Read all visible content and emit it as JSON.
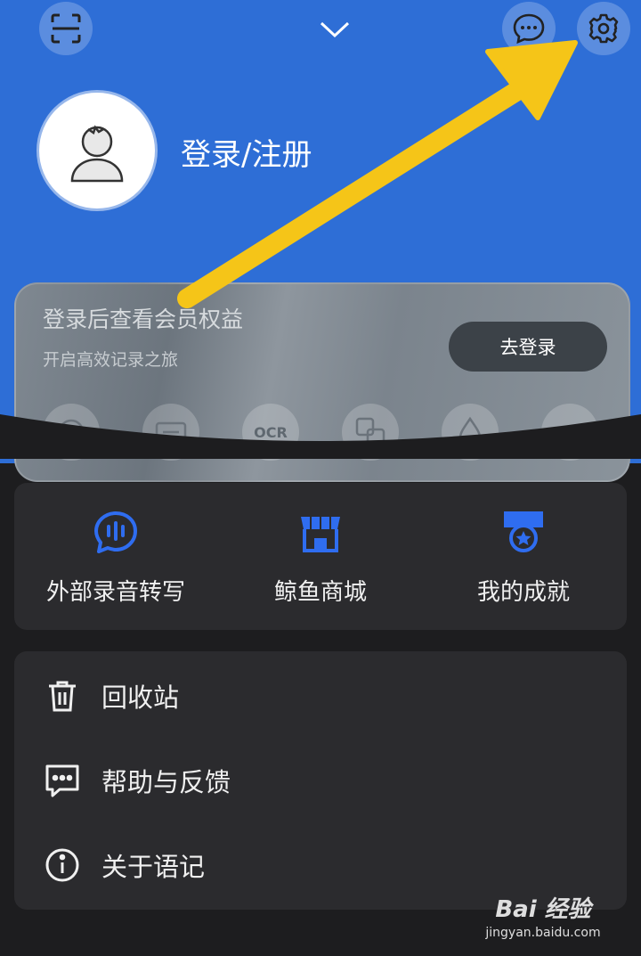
{
  "header": {
    "profile_name": "登录/注册",
    "colors": {
      "header_bg": "#2e6ed6",
      "accent": "#2f6df0",
      "arrow": "#f5c518"
    }
  },
  "member_card": {
    "title": "登录后查看会员权益",
    "subtitle": "开启高效记录之旅",
    "button_label": "去登录",
    "perks": [
      {
        "icon": "voice-icon"
      },
      {
        "icon": "recorder-icon"
      },
      {
        "icon": "ocr-icon",
        "text": "OCR"
      },
      {
        "icon": "translate-icon"
      },
      {
        "icon": "water-drop-icon"
      },
      {
        "icon": "more-perk-icon"
      }
    ]
  },
  "features": [
    {
      "label": "外部录音转写",
      "icon": "waveform-chat-icon"
    },
    {
      "label": "鲸鱼商城",
      "icon": "store-icon"
    },
    {
      "label": "我的成就",
      "icon": "achievement-badge-icon"
    }
  ],
  "menu": [
    {
      "label": "回收站",
      "icon": "trash-icon"
    },
    {
      "label": "帮助与反馈",
      "icon": "feedback-icon"
    },
    {
      "label": "关于语记",
      "icon": "info-icon"
    }
  ],
  "watermark": {
    "logo": "Bai 经验",
    "url": "jingyan.baidu.com"
  }
}
